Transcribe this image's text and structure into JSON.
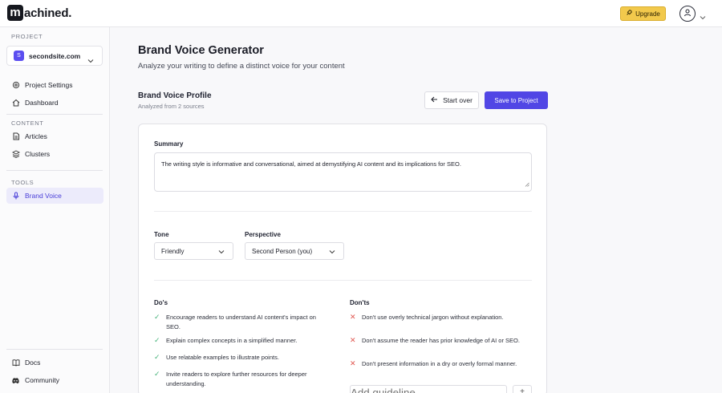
{
  "app": {
    "logo_text": "achined.",
    "logo_letter": "m"
  },
  "header": {
    "upgrade_label": "Upgrade"
  },
  "sidebar": {
    "project_section": "PROJECT",
    "project": {
      "badge": "S",
      "name": "secondsite.com"
    },
    "project_items": [
      {
        "label": "Project Settings",
        "icon": "gear-icon"
      },
      {
        "label": "Dashboard",
        "icon": "home-icon"
      }
    ],
    "content_section": "CONTENT",
    "content_items": [
      {
        "label": "Articles",
        "icon": "document-icon"
      },
      {
        "label": "Clusters",
        "icon": "layers-icon"
      }
    ],
    "tools_section": "TOOLS",
    "tools_items": [
      {
        "label": "Brand Voice",
        "icon": "microphone-icon",
        "active": true
      }
    ],
    "footer_items": [
      {
        "label": "Docs",
        "icon": "book-icon"
      },
      {
        "label": "Community",
        "icon": "discord-icon"
      }
    ]
  },
  "main": {
    "title": "Brand Voice Generator",
    "subtitle": "Analyze your writing to define a distinct voice for your content",
    "profile_title": "Brand Voice Profile",
    "profile_sub": "Analyzed from 2 sources",
    "start_over_label": "Start over",
    "save_label": "Save to Project",
    "summary_label": "Summary",
    "summary_text": "The writing style is informative and conversational, aimed at demystifying AI content and its implications for SEO.",
    "tone_label": "Tone",
    "tone_value": "Friendly",
    "perspective_label": "Perspective",
    "perspective_value": "Second Person (you)",
    "dos_label": "Do's",
    "dos": [
      "Encourage readers to understand AI content's impact on SEO.",
      "Explain complex concepts in a simplified manner.",
      "Use relatable examples to illustrate points.",
      "Invite readers to explore further resources for deeper understanding."
    ],
    "donts_label": "Don'ts",
    "donts": [
      "Don't use overly technical jargon without explanation.",
      "Don't assume the reader has prior knowledge of AI or SEO.",
      "Don't present information in a dry or overly formal manner."
    ],
    "add_placeholder": "Add guideline",
    "add_button": "+"
  },
  "colors": {
    "accent": "#5146e5",
    "upgrade": "#f2c94c",
    "check": "#46b37a",
    "cross": "#e0554f"
  }
}
